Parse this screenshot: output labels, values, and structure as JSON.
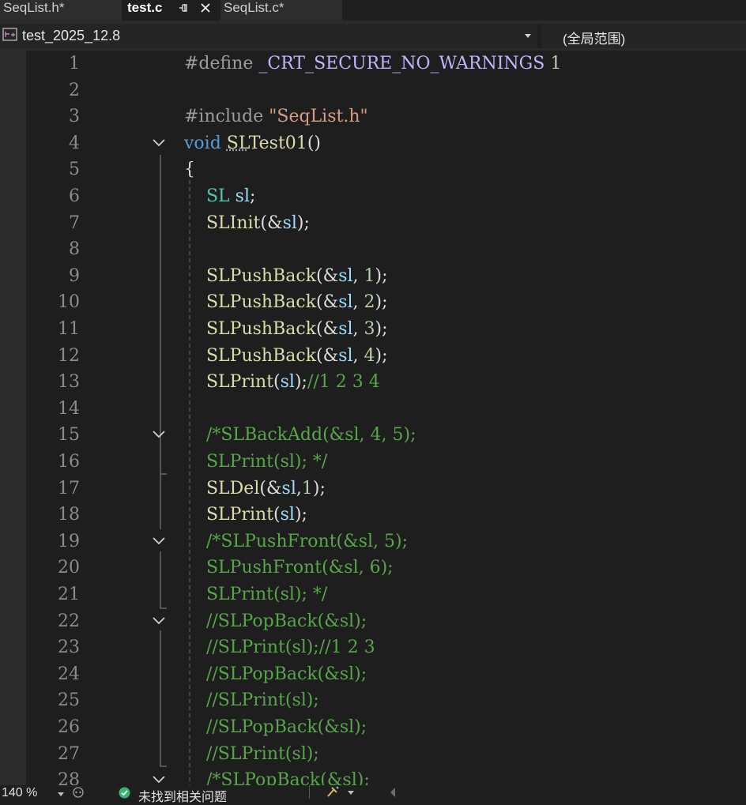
{
  "tabs": [
    {
      "label": "SeqList.h*"
    },
    {
      "label": "test.c"
    },
    {
      "label": "SeqList.c*"
    }
  ],
  "navbar": {
    "project": "test_2025_12.8",
    "scope": "(全局范围)"
  },
  "editor": {
    "line_numbers": [
      "1",
      "2",
      "3",
      "4",
      "5",
      "6",
      "7",
      "8",
      "9",
      "10",
      "11",
      "12",
      "13",
      "14",
      "15",
      "16",
      "17",
      "18",
      "19",
      "20",
      "21",
      "22",
      "23",
      "24",
      "25",
      "26",
      "27",
      "28"
    ],
    "lines": [
      "#define _CRT_SECURE_NO_WARNINGS 1",
      "",
      "#include \"SeqList.h\"",
      "void SLTest01()",
      "{",
      "    SL sl;",
      "    SLInit(&sl);",
      "",
      "    SLPushBack(&sl, 1);",
      "    SLPushBack(&sl, 2);",
      "    SLPushBack(&sl, 3);",
      "    SLPushBack(&sl, 4);",
      "    SLPrint(sl);//1 2 3 4",
      "",
      "    /*SLBackAdd(&sl, 4, 5);",
      "    SLPrint(sl); */",
      "    SLDel(&sl,1);",
      "    SLPrint(sl);",
      "    /*SLPushFront(&sl, 5);",
      "    SLPushFront(&sl, 6);",
      "    SLPrint(sl); */",
      "    //SLPopBack(&sl);",
      "    //SLPrint(sl);//1 2 3",
      "    //SLPopBack(&sl);",
      "    //SLPrint(sl);",
      "    //SLPopBack(&sl);",
      "    //SLPrint(sl);",
      "    /*SLPopBack(&sl);"
    ],
    "fold_lines": [
      4,
      15,
      19,
      22,
      28
    ]
  },
  "status": {
    "zoom": "140 %",
    "issues": "未找到相关问题"
  },
  "colors": {
    "background": "#1e1e1e",
    "keyword": "#569cd6",
    "type": "#4ec9b0",
    "function": "#dcdcaa",
    "variable": "#9cdcfe",
    "number": "#b5cea8",
    "string": "#d69d85",
    "comment": "#57a64a",
    "ok": "#3cb371"
  }
}
